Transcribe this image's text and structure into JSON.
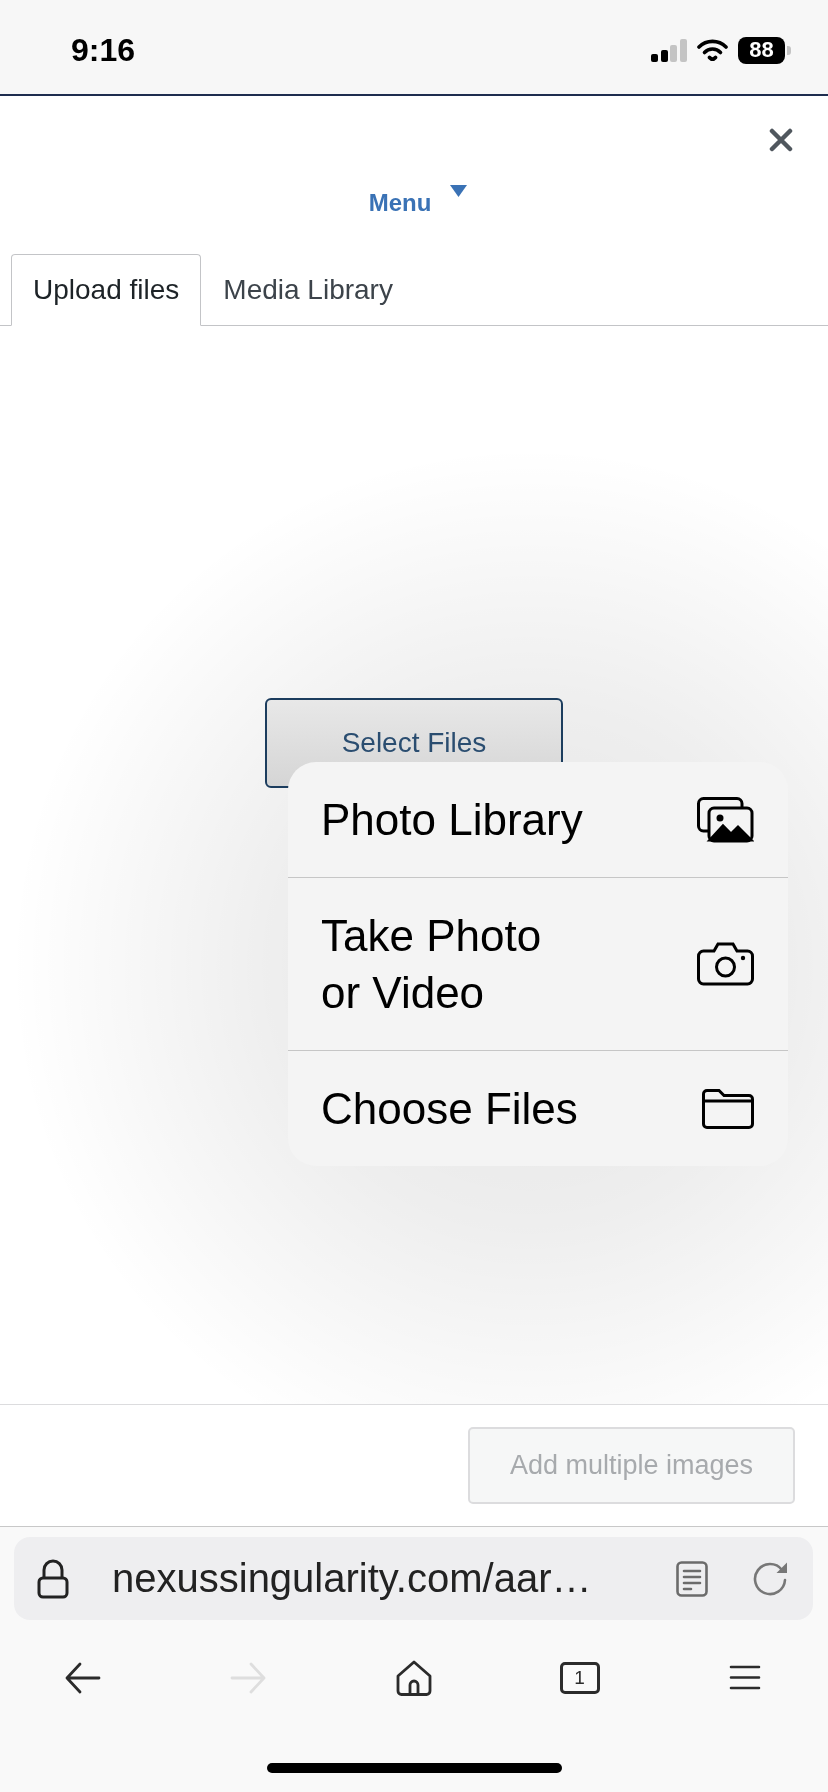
{
  "status_bar": {
    "time": "9:16",
    "battery": "88"
  },
  "dialog": {
    "menu": "Menu",
    "tabs": [
      {
        "label": "Upload files",
        "selected": true
      },
      {
        "label": "Media Library",
        "selected": false
      }
    ],
    "select_button": "Select Files",
    "add_button": {
      "label": "Add multiple images",
      "disabled": true
    }
  },
  "picker_menu": {
    "items": [
      {
        "label": "Photo Library"
      },
      {
        "label": "Take Photo\nor Video"
      },
      {
        "label": "Choose Files"
      }
    ]
  },
  "browser": {
    "url": "nexussingularity.com/aar…",
    "tab_count": "1",
    "forward_disabled": true
  }
}
